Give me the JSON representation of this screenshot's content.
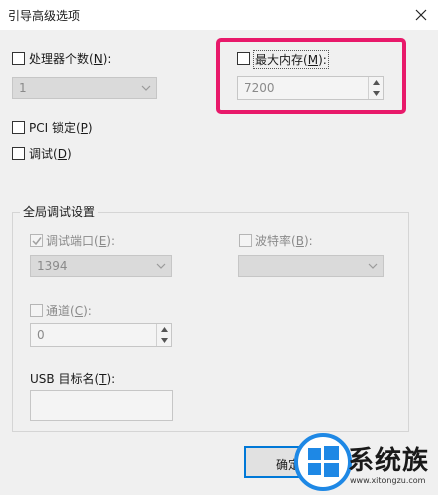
{
  "window": {
    "title": "引导高级选项"
  },
  "processors": {
    "label": "处理器个数",
    "accel": "N",
    "value": "1"
  },
  "max_memory": {
    "label": "最大内存",
    "accel": "M",
    "value": "7200"
  },
  "pci_lock": {
    "label": "PCI 锁定",
    "accel": "P"
  },
  "debug": {
    "label": "调试",
    "accel": "D"
  },
  "global_debug": {
    "title": "全局调试设置",
    "debug_port": {
      "label": "调试端口",
      "accel": "E",
      "value": "1394"
    },
    "baud_rate": {
      "label": "波特率",
      "accel": "B",
      "value": ""
    },
    "channel": {
      "label": "通道",
      "accel": "C",
      "value": "0"
    },
    "usb_target": {
      "label": "USB 目标名",
      "accel": "T",
      "value": ""
    }
  },
  "buttons": {
    "ok": "确定"
  },
  "watermark": {
    "brand": "系统族",
    "url": "www.xitongzu.com"
  },
  "colors": {
    "highlight": "#e8196a",
    "focus": "#0078d7"
  }
}
